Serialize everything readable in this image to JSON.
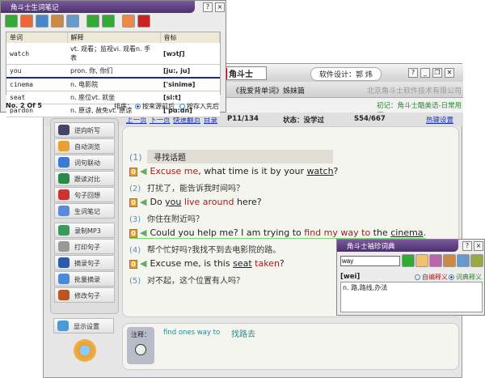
{
  "main": {
    "logo": "角斗士",
    "designer": "软件设计：郭 炜",
    "book_title": "《我爱背单词》姊妹篇",
    "company": "北京角斗士软件技术有限公司",
    "course": "初记：角斗士酷美语-日常用语",
    "nav": {
      "prev": "上一页",
      "next": "下一页",
      "fast": "快速翻页",
      "toc": "目录",
      "page": "P11/134",
      "status": "状态：没学过",
      "sentence": "S54/667",
      "hotkeys": "热键设置"
    },
    "window_buttons": [
      "?",
      "_",
      "❐",
      "✕"
    ],
    "sidebar": [
      "逆向听写",
      "自动浏览",
      "词句联动",
      "跟读对比",
      "句子回想",
      "生词笔记",
      "录制MP3",
      "打印句子",
      "摘录句子",
      "批量摘录",
      "修改句子"
    ],
    "display_settings": "显示设置",
    "topic": {
      "num": "(1)",
      "text": "寻找话题"
    },
    "sentences": [
      {
        "badge": "0",
        "parts": [
          {
            "t": "Excuse me",
            "c": "red"
          },
          {
            "t": ", what time is it by your "
          },
          {
            "t": "watch",
            "c": "u"
          },
          {
            "t": "?"
          }
        ],
        "num": "(2)",
        "cn": "打扰了，能告诉我时间吗？"
      },
      {
        "badge": "0",
        "parts": [
          {
            "t": "Do "
          },
          {
            "t": "you",
            "c": "u"
          },
          {
            "t": " "
          },
          {
            "t": "live around",
            "c": "red"
          },
          {
            "t": " here?"
          }
        ],
        "num": "(3)",
        "cn": "你住在附近吗？"
      },
      {
        "badge": "0",
        "parts": [
          {
            "t": "Could you help me? I am trying to "
          },
          {
            "t": "find my way to",
            "c": "red"
          },
          {
            "t": " the "
          },
          {
            "t": "cinema",
            "c": "u"
          },
          {
            "t": "."
          }
        ],
        "num": "(4)",
        "cn": "帮个忙好吗?我找不到去电影院的路。"
      },
      {
        "badge": "0",
        "parts": [
          {
            "t": "Excuse me, is this "
          },
          {
            "t": "seat",
            "c": "u"
          },
          {
            "t": " "
          },
          {
            "t": "taken",
            "c": "red"
          },
          {
            "t": "?"
          }
        ],
        "num": "(5)",
        "cn": "对不起，这个位置有人吗？"
      }
    ],
    "notes": {
      "label": "注释：",
      "en": "find ones way to",
      "cn": "找路去"
    }
  },
  "vocab": {
    "title": "角斗士生词笔记",
    "headers": [
      "单词",
      "解释",
      "音标"
    ],
    "rows": [
      [
        "watch",
        "vt. 观看；监视vi. 观看n. 手表",
        "[wɔtʃ]"
      ],
      [
        "you",
        "pron. 你, 你们",
        "[ju:, ju]"
      ],
      [
        "cinema",
        "n. 电影院",
        "['sinimə]"
      ],
      [
        "seat",
        "n. 座位vt. 就坐",
        "[si:t]"
      ],
      [
        "pardon",
        "n. 原谅, 赦免vt. 原谅",
        "['pɑ:dn]"
      ]
    ],
    "status": "No. 2 Of 5",
    "sort_label": "排序：",
    "sort_options": [
      "按来源前后",
      "按存入先后"
    ],
    "sort_selected": 0
  },
  "dict": {
    "title": "角斗士袖珍词典",
    "input": "way",
    "phonetic": "[wei]",
    "options": [
      "自编释义",
      "词典释义"
    ],
    "selected": 1,
    "definition": "n. 路,路线,办法"
  },
  "colors": {
    "title_purple": "#5a3a7e",
    "red": "#b01818",
    "link": "#1a2fb0",
    "green": "#2a8a2a"
  }
}
